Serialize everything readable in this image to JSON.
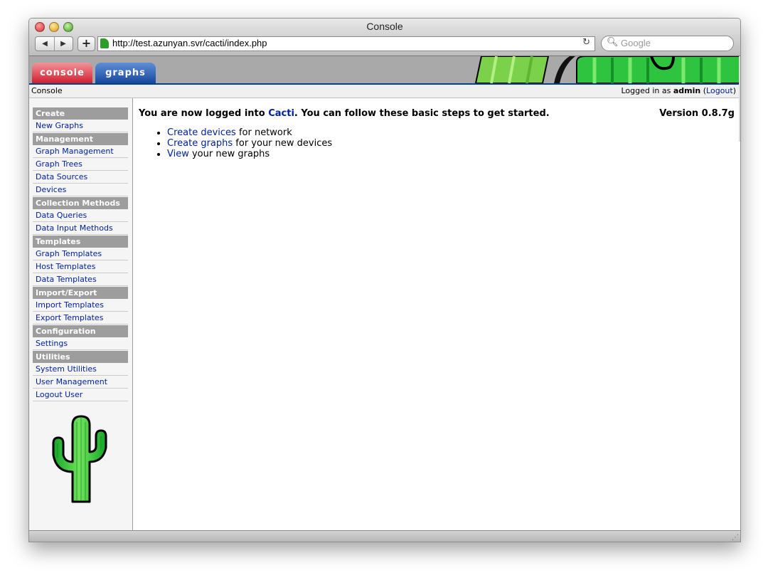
{
  "window": {
    "title": "Console"
  },
  "browser": {
    "url": "http://test.azunyan.svr/cacti/index.php",
    "search_placeholder": "Google"
  },
  "tabs": {
    "console": "console",
    "graphs": "graphs"
  },
  "breadcrumb": "Console",
  "login": {
    "prefix": "Logged in as",
    "user": "admin",
    "open": "(",
    "logout": "Logout",
    "close": ")"
  },
  "menu": {
    "create": {
      "header": "Create",
      "items": [
        "New Graphs"
      ]
    },
    "management": {
      "header": "Management",
      "items": [
        "Graph Management",
        "Graph Trees",
        "Data Sources",
        "Devices"
      ]
    },
    "collection": {
      "header": "Collection Methods",
      "items": [
        "Data Queries",
        "Data Input Methods"
      ]
    },
    "templates": {
      "header": "Templates",
      "items": [
        "Graph Templates",
        "Host Templates",
        "Data Templates"
      ]
    },
    "import_export": {
      "header": "Import/Export",
      "items": [
        "Import Templates",
        "Export Templates"
      ]
    },
    "configuration": {
      "header": "Configuration",
      "items": [
        "Settings"
      ]
    },
    "utilities": {
      "header": "Utilities",
      "items": [
        "System Utilities",
        "User Management",
        "Logout User"
      ]
    }
  },
  "main": {
    "welcome_prefix": "You are now logged into",
    "welcome_link": "Cacti",
    "welcome_suffix": ". You can follow these basic steps to get started.",
    "version": "Version 0.8.7g",
    "steps": [
      {
        "link": "Create devices",
        "text": " for network"
      },
      {
        "link": "Create graphs",
        "text": " for your new devices"
      },
      {
        "link": "View",
        "text": " your new graphs"
      }
    ]
  },
  "colors": {
    "link": "#00219c",
    "menu_header": "#9d9d9d",
    "tab_console": "#d01f2f",
    "tab_graphs": "#17479b",
    "banner_line": "#00428c"
  }
}
